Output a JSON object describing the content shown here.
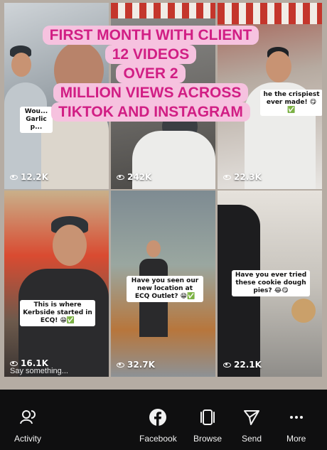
{
  "overlay": {
    "lines": [
      "FIRST MONTH WITH CLIENT",
      "12 VIDEOS",
      "OVER 2",
      "MILLION VIEWS ACROSS",
      "TIKTOK AND INSTAGRAM"
    ],
    "bg_color": "#f6c2df",
    "text_color": "#d11e84"
  },
  "tiles": [
    {
      "views": "12.2K",
      "caption": "Wou... Garlic p..."
    },
    {
      "views": "242K"
    },
    {
      "views": "22.3K",
      "caption": "he the crispiest ever made! 😋✅"
    },
    {
      "views": "16.1K",
      "caption": "This is where Kerbside started in ECQ! 😁✅"
    },
    {
      "views": "32.7K",
      "caption": "Have you seen our new location at ECQ Outlet? 😁✅"
    },
    {
      "views": "22.1K",
      "caption": "Have you ever tried these cookie dough pies? 😂😋"
    }
  ],
  "comment_placeholder": "Say something...",
  "nav": {
    "activity": "Activity",
    "facebook": "Facebook",
    "browse": "Browse",
    "send": "Send",
    "more": "More"
  }
}
